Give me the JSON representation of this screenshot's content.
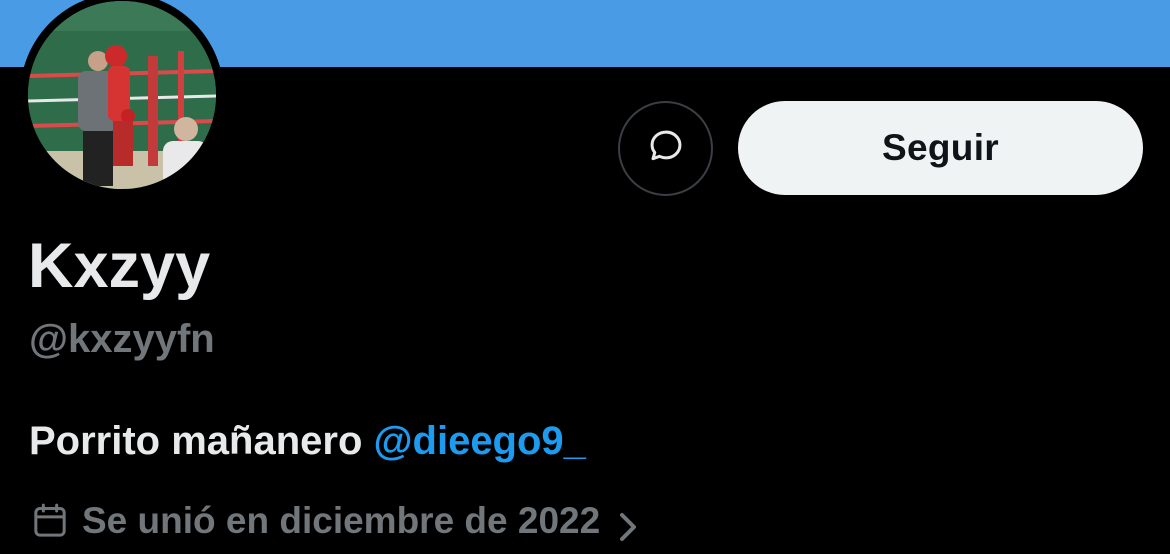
{
  "profile": {
    "display_name": "Kxzyy",
    "handle": "@kxzyyfn",
    "bio_text": "Porrito mañanero ",
    "bio_mention": "@dieego9_",
    "joined": "Se unió en diciembre de 2022"
  },
  "actions": {
    "follow_label": "Seguir",
    "message_icon": "message-bubble-icon"
  },
  "icons": {
    "joined_icon": "calendar-icon",
    "chevron_icon": "chevron-right-icon"
  },
  "colors": {
    "banner": "#4a9be6",
    "background": "#000000",
    "primary_text": "#e7e9ea",
    "secondary_text": "#71767b",
    "mention": "#1d9bf0",
    "follow_button_bg": "#eff3f4"
  }
}
